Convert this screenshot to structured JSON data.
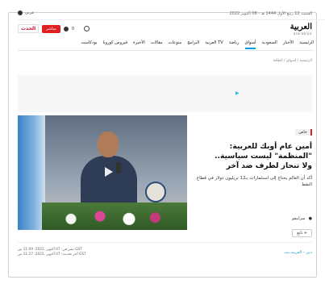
{
  "topbar": {
    "date": "السبت 12 ربيع الأول 1444 هـ - 08 أكتوبر 2022",
    "lang": "عربي"
  },
  "logo": {
    "arabic": "العربية",
    "english": "alarabiya"
  },
  "header": {
    "live_label": "مباشر",
    "hadath_label": "الحدث",
    "mini_label": "0"
  },
  "nav": {
    "items": [
      "الرئيسية",
      "الأخبار",
      "السعودية",
      "أسواق",
      "رياضة",
      "العربية TV",
      "البرامج",
      "منوعات",
      "مقالات",
      "الأخيرة",
      "فيروس كورونا",
      "بودكاست"
    ],
    "active_index": 3
  },
  "breadcrumbs": "الرئيسية / أسواق / الطاقة",
  "ad": {
    "mark": "▶"
  },
  "article": {
    "tag": "خاص",
    "title_lines": [
      "أمين عام أوبك للعربية:",
      "\"المنظمة\" ليست سياسية..",
      "ولا تنحاز لطرف ضد آخر"
    ],
    "summary": "أكد أن العالم يحتاج إلى استثمارات بـ12 تريليون دولار في قطاع النفط",
    "location": "سراييفو",
    "follow": "تابع +",
    "source": "دبي - العربية.نت",
    "published": "نشر في: 07 أكتوبر ,2022: 11:09 ص GST",
    "updated": "آخر تحديث: 07 أكتوبر ,2022: 11:27 ص GST"
  },
  "colors": {
    "accent_red": "#e02020",
    "accent_blue": "#00a0e0"
  }
}
